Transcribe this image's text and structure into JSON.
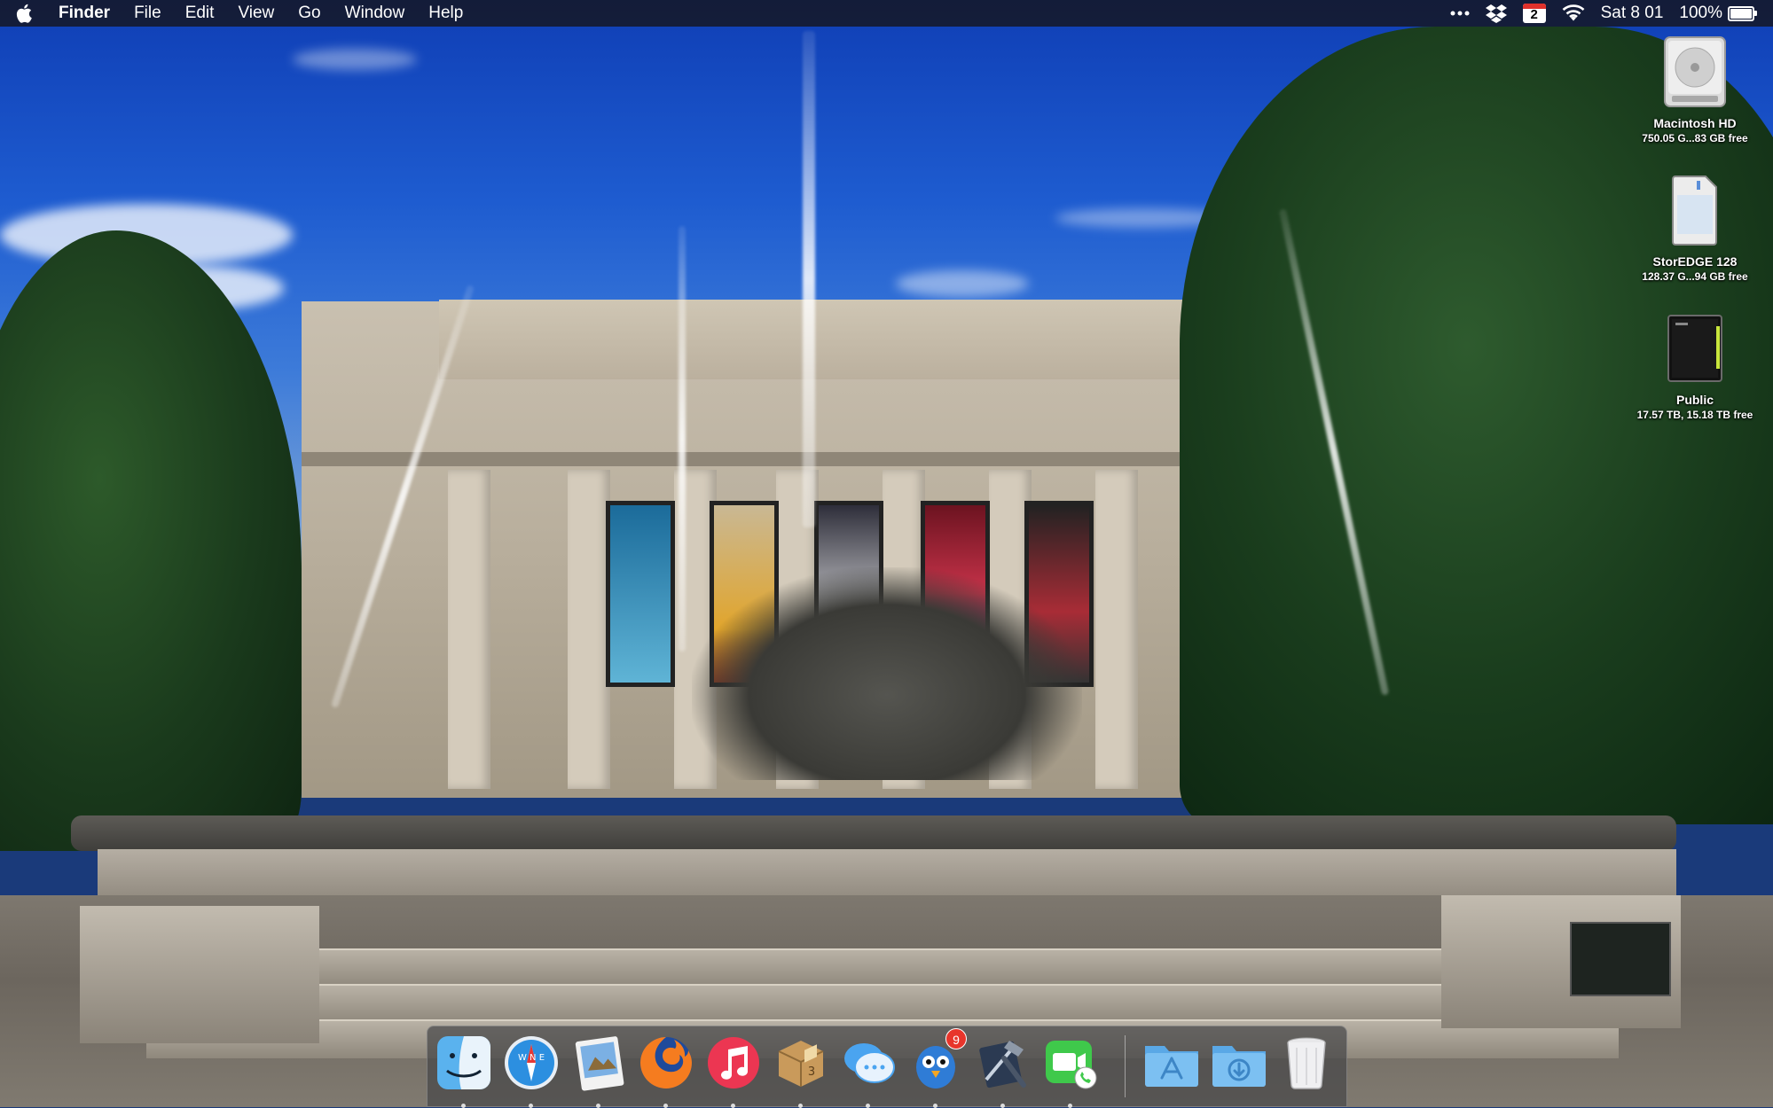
{
  "menubar": {
    "apple_icon": "apple-icon",
    "app_name": "Finder",
    "menus": [
      "File",
      "Edit",
      "View",
      "Go",
      "Window",
      "Help"
    ],
    "status": {
      "calendar_date": "2",
      "clock": "Sat 8 01",
      "battery_percent": "100%",
      "battery_level": 1.0
    }
  },
  "desktop_icons": [
    {
      "name": "Macintosh HD",
      "info": "750.05 G...83 GB free",
      "icon": "hard-drive-icon"
    },
    {
      "name": "StorEDGE 128",
      "info": "128.37 G...94 GB free",
      "icon": "sd-card-icon"
    },
    {
      "name": "Public",
      "info": "17.57 TB, 15.18 TB free",
      "icon": "network-volume-icon"
    }
  ],
  "dock": {
    "items": [
      {
        "name": "Finder",
        "icon": "finder-icon",
        "running": true
      },
      {
        "name": "Safari",
        "icon": "compass-icon",
        "running": true
      },
      {
        "name": "Preview",
        "icon": "preview-icon",
        "running": true
      },
      {
        "name": "Firefox",
        "icon": "firefox-icon",
        "running": true
      },
      {
        "name": "iTunes",
        "icon": "music-note-icon",
        "running": true
      },
      {
        "name": "Delivery Status",
        "icon": "package-icon",
        "badge_text": "3",
        "running": true
      },
      {
        "name": "Messages",
        "icon": "speech-bubbles-icon",
        "running": true
      },
      {
        "name": "Tweetbot",
        "icon": "bird-icon",
        "badge": "9",
        "running": true
      },
      {
        "name": "Xcode",
        "icon": "hammer-icon",
        "running": true
      },
      {
        "name": "FaceTime",
        "icon": "video-camera-icon",
        "running": true
      },
      {
        "name": "Applications",
        "icon": "applications-folder-icon",
        "running": false
      },
      {
        "name": "Downloads",
        "icon": "downloads-folder-icon",
        "running": false
      },
      {
        "name": "Trash",
        "icon": "trash-icon",
        "running": false
      }
    ]
  },
  "colors": {
    "menubar_bg": "#141828",
    "badge_red": "#e8352b",
    "folder_blue": "#5aa8e6"
  }
}
